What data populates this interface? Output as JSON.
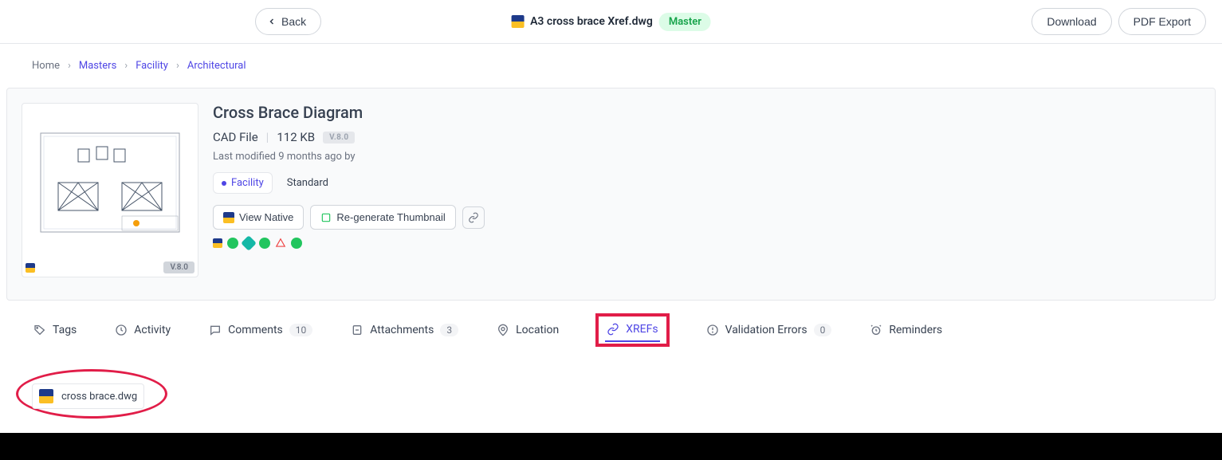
{
  "topbar": {
    "back": "Back",
    "filename": "A3 cross brace Xref.dwg",
    "badge": "Master",
    "download": "Download",
    "pdf_export": "PDF Export"
  },
  "breadcrumb": {
    "home": "Home",
    "masters": "Masters",
    "facility": "Facility",
    "architectural": "Architectural"
  },
  "detail": {
    "title": "Cross Brace Diagram",
    "type": "CAD File",
    "size": "112 KB",
    "version": "V.8.0",
    "last_modified": "Last modified 9 months ago by",
    "chip_facility": "Facility",
    "chip_standard": "Standard",
    "view_native": "View Native",
    "regen": "Re-generate Thumbnail",
    "thumb_version": "V.8.0"
  },
  "tabs": {
    "tags": "Tags",
    "activity": "Activity",
    "comments": "Comments",
    "comments_count": "10",
    "attachments": "Attachments",
    "attachments_count": "3",
    "location": "Location",
    "xrefs": "XREFs",
    "validation": "Validation Errors",
    "validation_count": "0",
    "reminders": "Reminders"
  },
  "xref": {
    "item1": "cross brace.dwg"
  }
}
